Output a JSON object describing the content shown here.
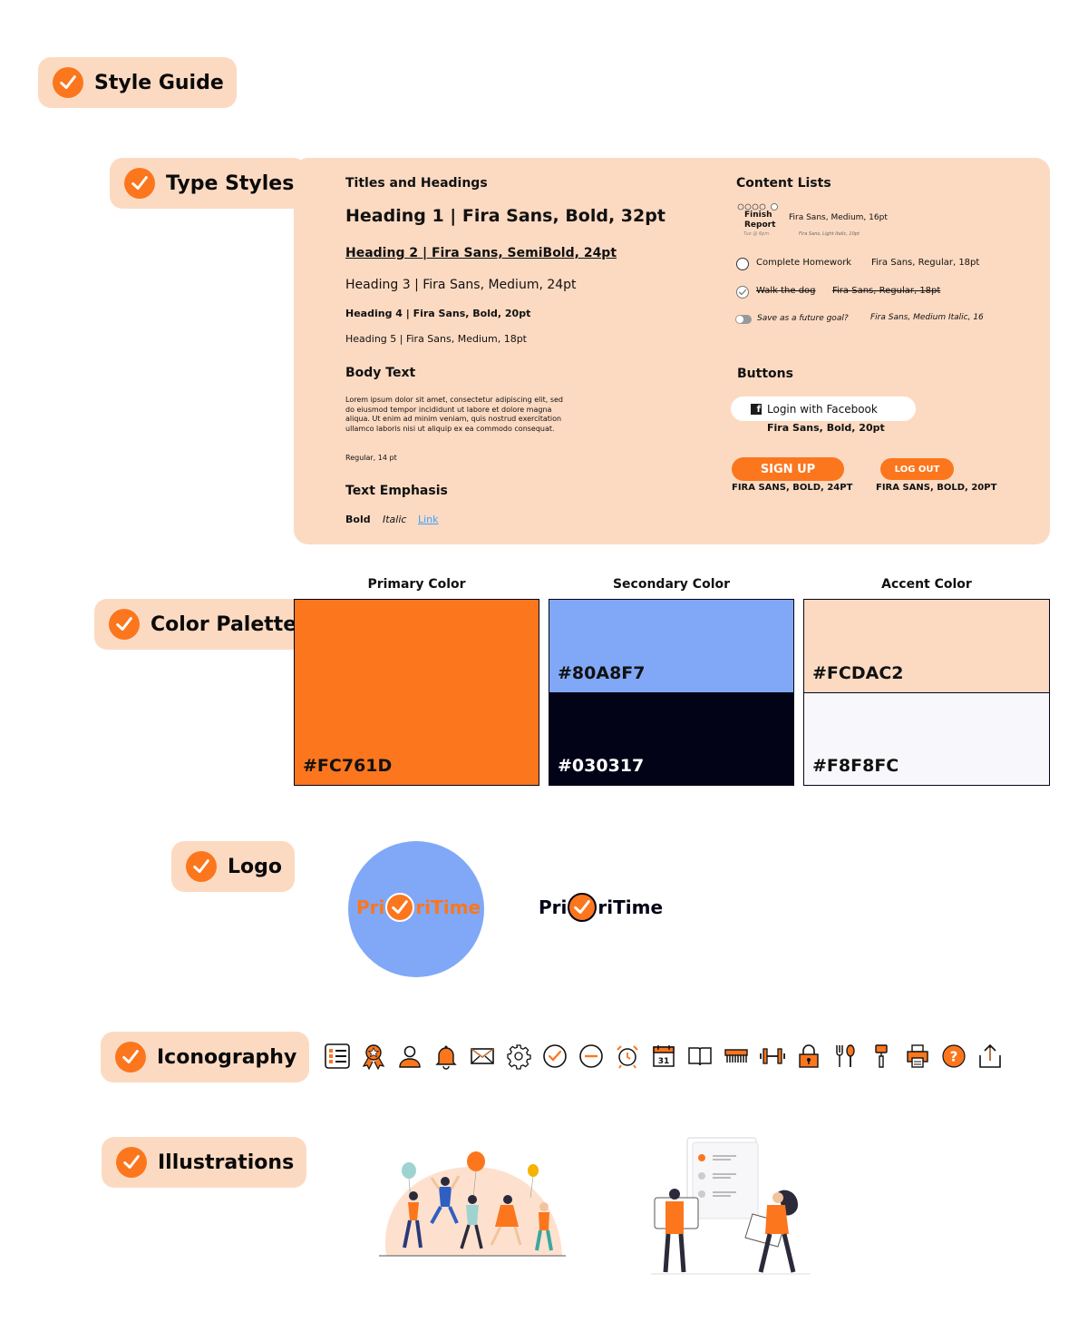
{
  "header": {
    "title": "Style Guide"
  },
  "sections": {
    "type_styles": "Type Styles",
    "color_palette": "Color Palette",
    "logo": "Logo",
    "iconography": "Iconography",
    "illustrations": "Illustrations"
  },
  "typography": {
    "titles_heading": "Titles and Headings",
    "h1": "Heading 1 | Fira Sans, Bold, 32pt",
    "h2": "Heading 2 | Fira Sans, SemiBold, 24pt",
    "h3": "Heading 3 | Fira Sans, Medium, 24pt",
    "h4": "Heading 4 | Fira Sans, Bold, 20pt",
    "h5": "Heading 5 | Fira Sans, Medium, 18pt",
    "body_heading": "Body Text",
    "body_text": "Lorem ipsum dolor sit amet, consectetur adipiscing elit, sed do eiusmod tempor incididunt ut labore et dolore magna aliqua. Ut enim ad minim veniam, quis nostrud exercitation ullamco laboris nisi ut aliquip ex ea commodo consequat.",
    "body_note": "Regular, 14 pt",
    "emphasis_heading": "Text Emphasis",
    "emphasis_bold": "Bold",
    "emphasis_italic": "Italic",
    "emphasis_link": "Link"
  },
  "content_lists": {
    "heading": "Content Lists",
    "finish_report_title": "Finish Report",
    "finish_report_time": "Tue @ 6pm",
    "finish_report_spec": "Fira Sans, Medium, 16pt",
    "finish_report_spec_small": "Fira Sans, Light Italic, 10pt",
    "complete_homework": "Complete Homework",
    "complete_homework_spec": "Fira Sans, Regular, 18pt",
    "walk_dog": "Walk the dog",
    "walk_dog_spec": "Fira Sans, Regular, 18pt",
    "future_goal": "Save as a future goal?",
    "future_goal_spec": "Fira Sans, Medium Italic, 16"
  },
  "buttons": {
    "heading": "Buttons",
    "facebook_label": "Login with Facebook",
    "facebook_spec": "Fira Sans, Bold, 20pt",
    "signup_label": "SIGN UP",
    "signup_spec": "FIRA SANS, BOLD, 24PT",
    "logout_label": "LOG OUT",
    "logout_spec": "FIRA SANS, BOLD, 20PT"
  },
  "palette": {
    "primary_title": "Primary Color",
    "secondary_title": "Secondary Color",
    "accent_title": "Accent Color",
    "primary": "#FC761D",
    "primary_label": "#FC761D",
    "secondary_top": "#80A8F7",
    "secondary_top_label": "#80A8F7",
    "secondary_bottom": "#030317",
    "secondary_bottom_label": "#030317",
    "accent_top": "#FCDAC2",
    "accent_top_label": "#FCDAC2",
    "accent_bottom": "#F8F8FC",
    "accent_bottom_label": "#F8F8FC"
  },
  "logo": {
    "prefix": "Pri",
    "suffix": "riTime"
  },
  "icons": [
    "checklist-icon",
    "award-ribbon-icon",
    "user-icon",
    "bell-icon",
    "mail-icon",
    "gear-icon",
    "check-circle-icon",
    "minus-circle-icon",
    "alarm-clock-icon",
    "calendar-icon",
    "book-icon",
    "comb-icon",
    "dumbbell-icon",
    "lock-icon",
    "fork-spoon-icon",
    "paint-roller-icon",
    "printer-icon",
    "help-icon",
    "share-icon"
  ],
  "calendar_day": "31"
}
